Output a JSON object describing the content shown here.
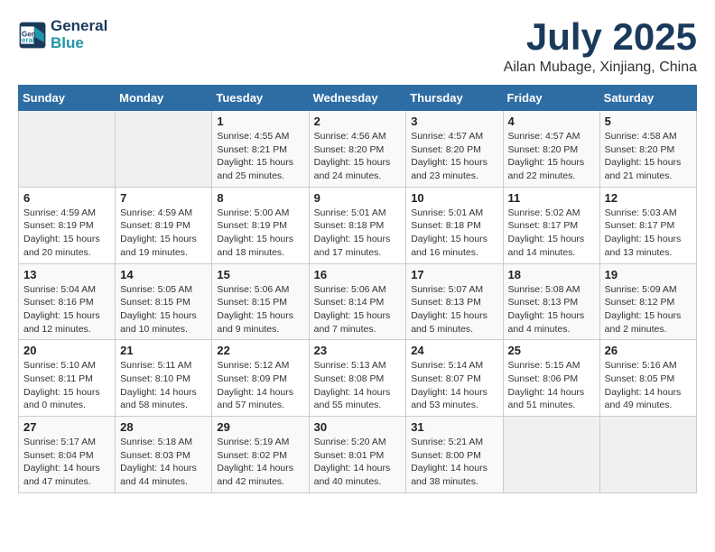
{
  "header": {
    "logo_line1": "General",
    "logo_line2": "Blue",
    "title": "July 2025",
    "subtitle": "Ailan Mubage, Xinjiang, China"
  },
  "calendar": {
    "weekdays": [
      "Sunday",
      "Monday",
      "Tuesday",
      "Wednesday",
      "Thursday",
      "Friday",
      "Saturday"
    ],
    "weeks": [
      [
        {
          "day": "",
          "info": ""
        },
        {
          "day": "",
          "info": ""
        },
        {
          "day": "1",
          "info": "Sunrise: 4:55 AM\nSunset: 8:21 PM\nDaylight: 15 hours\nand 25 minutes."
        },
        {
          "day": "2",
          "info": "Sunrise: 4:56 AM\nSunset: 8:20 PM\nDaylight: 15 hours\nand 24 minutes."
        },
        {
          "day": "3",
          "info": "Sunrise: 4:57 AM\nSunset: 8:20 PM\nDaylight: 15 hours\nand 23 minutes."
        },
        {
          "day": "4",
          "info": "Sunrise: 4:57 AM\nSunset: 8:20 PM\nDaylight: 15 hours\nand 22 minutes."
        },
        {
          "day": "5",
          "info": "Sunrise: 4:58 AM\nSunset: 8:20 PM\nDaylight: 15 hours\nand 21 minutes."
        }
      ],
      [
        {
          "day": "6",
          "info": "Sunrise: 4:59 AM\nSunset: 8:19 PM\nDaylight: 15 hours\nand 20 minutes."
        },
        {
          "day": "7",
          "info": "Sunrise: 4:59 AM\nSunset: 8:19 PM\nDaylight: 15 hours\nand 19 minutes."
        },
        {
          "day": "8",
          "info": "Sunrise: 5:00 AM\nSunset: 8:19 PM\nDaylight: 15 hours\nand 18 minutes."
        },
        {
          "day": "9",
          "info": "Sunrise: 5:01 AM\nSunset: 8:18 PM\nDaylight: 15 hours\nand 17 minutes."
        },
        {
          "day": "10",
          "info": "Sunrise: 5:01 AM\nSunset: 8:18 PM\nDaylight: 15 hours\nand 16 minutes."
        },
        {
          "day": "11",
          "info": "Sunrise: 5:02 AM\nSunset: 8:17 PM\nDaylight: 15 hours\nand 14 minutes."
        },
        {
          "day": "12",
          "info": "Sunrise: 5:03 AM\nSunset: 8:17 PM\nDaylight: 15 hours\nand 13 minutes."
        }
      ],
      [
        {
          "day": "13",
          "info": "Sunrise: 5:04 AM\nSunset: 8:16 PM\nDaylight: 15 hours\nand 12 minutes."
        },
        {
          "day": "14",
          "info": "Sunrise: 5:05 AM\nSunset: 8:15 PM\nDaylight: 15 hours\nand 10 minutes."
        },
        {
          "day": "15",
          "info": "Sunrise: 5:06 AM\nSunset: 8:15 PM\nDaylight: 15 hours\nand 9 minutes."
        },
        {
          "day": "16",
          "info": "Sunrise: 5:06 AM\nSunset: 8:14 PM\nDaylight: 15 hours\nand 7 minutes."
        },
        {
          "day": "17",
          "info": "Sunrise: 5:07 AM\nSunset: 8:13 PM\nDaylight: 15 hours\nand 5 minutes."
        },
        {
          "day": "18",
          "info": "Sunrise: 5:08 AM\nSunset: 8:13 PM\nDaylight: 15 hours\nand 4 minutes."
        },
        {
          "day": "19",
          "info": "Sunrise: 5:09 AM\nSunset: 8:12 PM\nDaylight: 15 hours\nand 2 minutes."
        }
      ],
      [
        {
          "day": "20",
          "info": "Sunrise: 5:10 AM\nSunset: 8:11 PM\nDaylight: 15 hours\nand 0 minutes."
        },
        {
          "day": "21",
          "info": "Sunrise: 5:11 AM\nSunset: 8:10 PM\nDaylight: 14 hours\nand 58 minutes."
        },
        {
          "day": "22",
          "info": "Sunrise: 5:12 AM\nSunset: 8:09 PM\nDaylight: 14 hours\nand 57 minutes."
        },
        {
          "day": "23",
          "info": "Sunrise: 5:13 AM\nSunset: 8:08 PM\nDaylight: 14 hours\nand 55 minutes."
        },
        {
          "day": "24",
          "info": "Sunrise: 5:14 AM\nSunset: 8:07 PM\nDaylight: 14 hours\nand 53 minutes."
        },
        {
          "day": "25",
          "info": "Sunrise: 5:15 AM\nSunset: 8:06 PM\nDaylight: 14 hours\nand 51 minutes."
        },
        {
          "day": "26",
          "info": "Sunrise: 5:16 AM\nSunset: 8:05 PM\nDaylight: 14 hours\nand 49 minutes."
        }
      ],
      [
        {
          "day": "27",
          "info": "Sunrise: 5:17 AM\nSunset: 8:04 PM\nDaylight: 14 hours\nand 47 minutes."
        },
        {
          "day": "28",
          "info": "Sunrise: 5:18 AM\nSunset: 8:03 PM\nDaylight: 14 hours\nand 44 minutes."
        },
        {
          "day": "29",
          "info": "Sunrise: 5:19 AM\nSunset: 8:02 PM\nDaylight: 14 hours\nand 42 minutes."
        },
        {
          "day": "30",
          "info": "Sunrise: 5:20 AM\nSunset: 8:01 PM\nDaylight: 14 hours\nand 40 minutes."
        },
        {
          "day": "31",
          "info": "Sunrise: 5:21 AM\nSunset: 8:00 PM\nDaylight: 14 hours\nand 38 minutes."
        },
        {
          "day": "",
          "info": ""
        },
        {
          "day": "",
          "info": ""
        }
      ]
    ]
  }
}
